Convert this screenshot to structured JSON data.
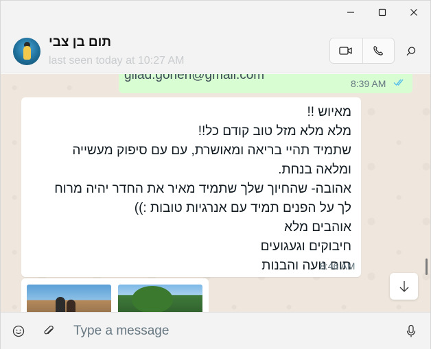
{
  "window": {
    "controls": [
      "minimize",
      "maximize",
      "close"
    ]
  },
  "header": {
    "contact_name": "תום בן צבי",
    "last_seen": "last seen today at 10:27 AM",
    "icons": [
      "video-call-icon",
      "voice-call-icon",
      "search-icon"
    ]
  },
  "messages": {
    "outgoing": {
      "text": "gilad.gonen@gmail.com",
      "time": "8:39 AM",
      "status": "read"
    },
    "incoming": {
      "lines": [
        "מאיוש !!",
        "מלא מלא מזל טוב קודם כל!!",
        "שתמיד תהיי בריאה ומאושרת, עם עם סיפוק מעשייה",
        "ומלאה בנחת.",
        "אהובה- שהחיוך שלך שתמיד מאיר את החדר יהיה מרוח",
        "לך על הפנים תמיד עם אנרגיות טובות :))",
        "אוהבים מלא",
        "חיבוקים וגעגועים",
        "תום נועה והבנות"
      ],
      "time": "8:46 AM"
    },
    "images_count": 2
  },
  "composer": {
    "placeholder": "Type a message"
  },
  "colors": {
    "outgoing_bubble": "#d9fdd3",
    "incoming_bubble": "#ffffff",
    "chat_background": "#efe7dd",
    "read_ticks": "#53bdeb"
  }
}
